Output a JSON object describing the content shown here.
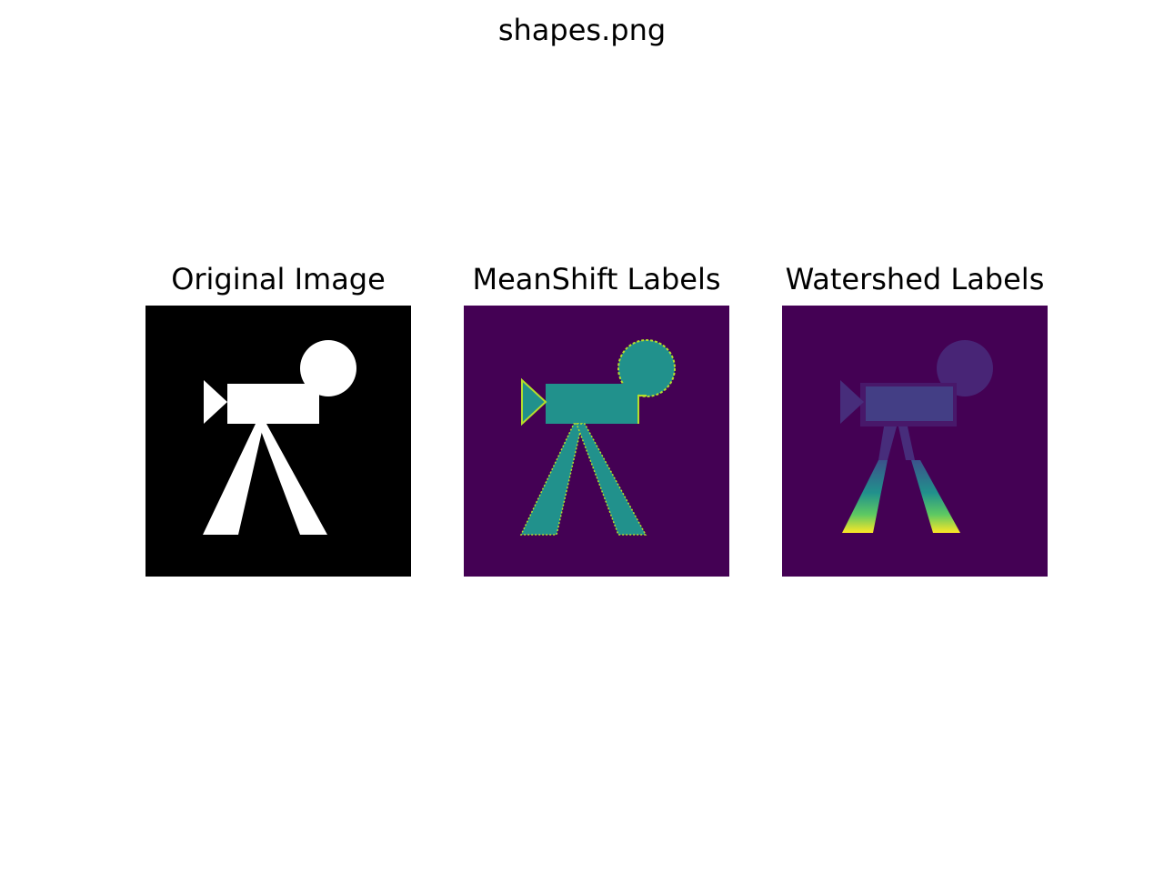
{
  "figure": {
    "title": "shapes.png"
  },
  "panels": [
    {
      "title": "Original Image",
      "background": "#000000",
      "colors": {
        "camera_body": "#ffffff",
        "lens": "#ffffff",
        "reel": "#ffffff",
        "legs": "#ffffff",
        "edge": "#ffffff"
      }
    },
    {
      "title": "MeanShift Labels",
      "background": "#440154",
      "colors": {
        "camera_body": "#21918c",
        "lens": "#21918c",
        "reel": "#21918c",
        "legs": "#21918c",
        "edge": "#b5de2b"
      }
    },
    {
      "title": "Watershed Labels",
      "background": "#440154",
      "colors": {
        "camera_body": "#433e85",
        "lens": "#472d7b",
        "reel": "#482576",
        "legs_top": "#3b528b",
        "legs_bottom": "#fde725",
        "edge": "#48186a"
      }
    }
  ]
}
